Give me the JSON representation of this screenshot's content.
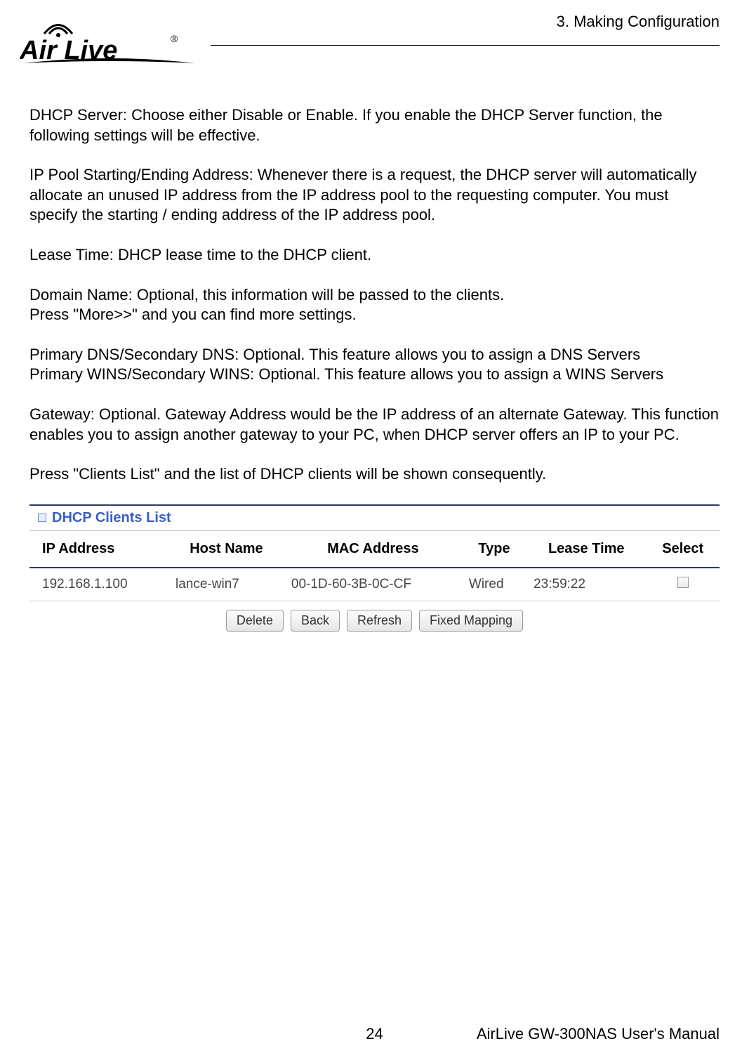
{
  "header": {
    "chapter": "3. Making Configuration",
    "logo_text": "Air Live",
    "logo_registered": "®"
  },
  "body": {
    "p1": "DHCP Server: Choose either Disable or Enable. If you enable the DHCP Server function, the following settings will be effective.",
    "p2": "IP Pool Starting/Ending Address: Whenever there is a request, the DHCP server will automatically allocate an unused IP address from the IP address pool to the requesting computer. You must specify the starting / ending address of the IP address pool.",
    "p3": "Lease Time: DHCP lease time to the DHCP client.",
    "p4a": "Domain Name: Optional, this information will be passed to the clients.",
    "p4b": "Press \"More>>\" and you can find more settings.",
    "p5a": "Primary DNS/Secondary DNS: Optional. This feature allows you to assign a DNS Servers",
    "p5b": "Primary WINS/Secondary WINS: Optional. This feature allows you to assign a WINS Servers",
    "p6": "Gateway: Optional. Gateway Address would be the IP address of an alternate Gateway. This function enables you to assign another gateway to your PC, when DHCP server offers an IP to your PC.",
    "p7": "Press \"Clients List\" and the list of DHCP clients will be shown consequently."
  },
  "panel": {
    "title": "DHCP Clients List",
    "columns": {
      "ip": "IP Address",
      "host": "Host Name",
      "mac": "MAC Address",
      "type": "Type",
      "lease": "Lease Time",
      "select": "Select"
    },
    "row": {
      "ip": "192.168.1.100",
      "host": "lance-win7",
      "mac": "00-1D-60-3B-0C-CF",
      "type": "Wired",
      "lease": "23:59:22"
    },
    "buttons": {
      "delete": "Delete",
      "back": "Back",
      "refresh": "Refresh",
      "fixed": "Fixed Mapping"
    }
  },
  "footer": {
    "page": "24",
    "title": "AirLive GW-300NAS User's Manual"
  }
}
